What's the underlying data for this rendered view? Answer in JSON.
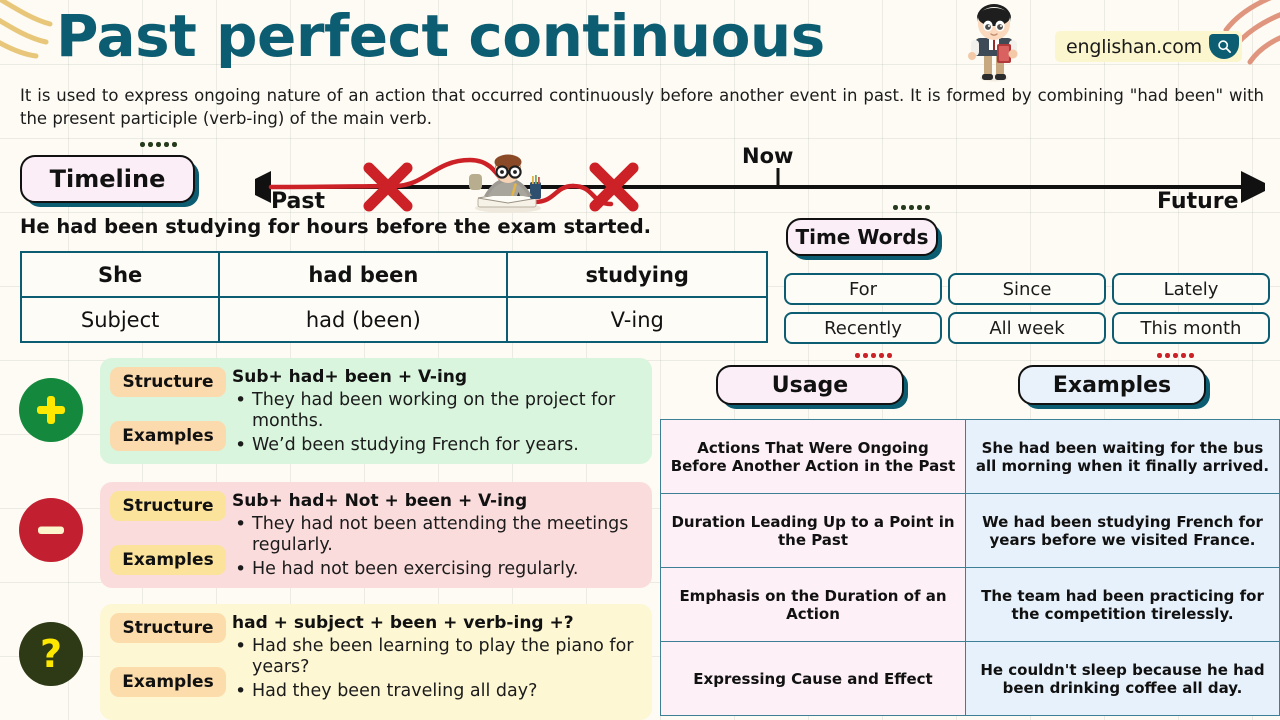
{
  "header": {
    "title": "Past perfect continuous",
    "brand": "englishan.com",
    "search_icon": "search-icon",
    "intro": "It is used to express ongoing nature of an action that occurred continuously before another event in past. It is formed by combining \"had been\" with the present participle (verb-ing) of the main verb."
  },
  "timeline": {
    "label": "Timeline",
    "past_label": "Past",
    "now_label": "Now",
    "future_label": "Future",
    "sentence": "He had been studying for hours before the exam started."
  },
  "structure_table": {
    "head": [
      "She",
      "had been",
      "studying"
    ],
    "body": [
      "Subject",
      "had (been)",
      "V-ing"
    ]
  },
  "time_words": {
    "label": "Time Words",
    "chips": [
      "For",
      "Since",
      "Lately",
      "Recently",
      "All week",
      "This month"
    ]
  },
  "forms": [
    {
      "type": "positive",
      "icon": "plus-icon",
      "structure_label": "Structure",
      "examples_label": "Examples",
      "structure": "Sub+ had+ been + V-ing",
      "examples": [
        "They had been working on the project for months.",
        "We’d been studying French for years."
      ],
      "bg": "#d9f5dd",
      "icon_color": "#14883c"
    },
    {
      "type": "negative",
      "icon": "minus-icon",
      "structure_label": "Structure",
      "examples_label": "Examples",
      "structure": "Sub+ had+ Not + been + V-ing",
      "examples": [
        "They had not been attending the meetings regularly.",
        "He had not been exercising regularly."
      ],
      "bg": "#fbdcdc",
      "icon_color": "#c22030"
    },
    {
      "type": "question",
      "icon": "question-mark-icon",
      "structure_label": "Structure",
      "examples_label": "Examples",
      "structure": "had + subject + been + verb-ing +?",
      "examples": [
        "Had she been learning to play the piano for years?",
        "Had they been traveling all day?"
      ],
      "bg": "#fdf7d4",
      "icon_color": "#2e3a16"
    }
  ],
  "usage_section": {
    "usage_label": "Usage",
    "examples_label": "Examples",
    "rows": [
      {
        "usage": "Actions That Were Ongoing Before Another Action in the Past",
        "example": "She had been waiting for the bus all morning when it finally arrived."
      },
      {
        "usage": "Duration Leading Up to a Point in the Past",
        "example": "We had been studying French for years before we visited France."
      },
      {
        "usage": "Emphasis on the Duration of an Action",
        "example": "The team had been practicing for the competition tirelessly."
      },
      {
        "usage": "Expressing Cause and Effect",
        "example": "He couldn't sleep because he had been drinking coffee all day."
      }
    ]
  },
  "colors": {
    "title": "#0d5d72",
    "teal_border": "#0d5d72",
    "background": "#fdfbf3",
    "red_marker": "#cc2127",
    "positive_green": "#14883c",
    "negative_red": "#c22030",
    "question_dark": "#2e3a16"
  }
}
